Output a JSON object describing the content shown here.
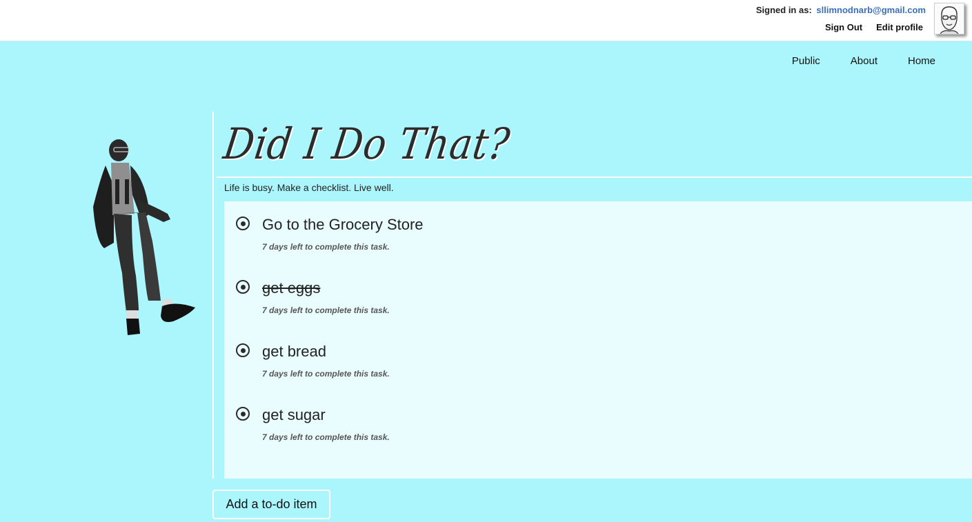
{
  "header": {
    "signed_in_label": "Signed in as:",
    "email": "sllimnodnarb@gmail.com",
    "sign_out": "Sign Out",
    "edit_profile": "Edit profile",
    "avatar_icon": "user-avatar-sketch"
  },
  "nav": {
    "items": [
      "Public",
      "About",
      "Home"
    ]
  },
  "hero": {
    "title": "Did I Do That?",
    "tagline": "Life is busy. Make a checklist. Live well.",
    "figure_icon": "dancing-man-figure"
  },
  "tasks": [
    {
      "name": "Go to the Grocery Store",
      "due": "7 days left to complete this task.",
      "completed": false
    },
    {
      "name": "get eggs",
      "due": "7 days left to complete this task.",
      "completed": true
    },
    {
      "name": "get bread",
      "due": "7 days left to complete this task.",
      "completed": false
    },
    {
      "name": "get sugar",
      "due": "7 days left to complete this task.",
      "completed": false
    }
  ],
  "add_button": "Add a to-do item",
  "colors": {
    "background": "#aaf6fc",
    "panel": "#eafdfe",
    "link": "#3a6fb8",
    "text": "#222222"
  }
}
